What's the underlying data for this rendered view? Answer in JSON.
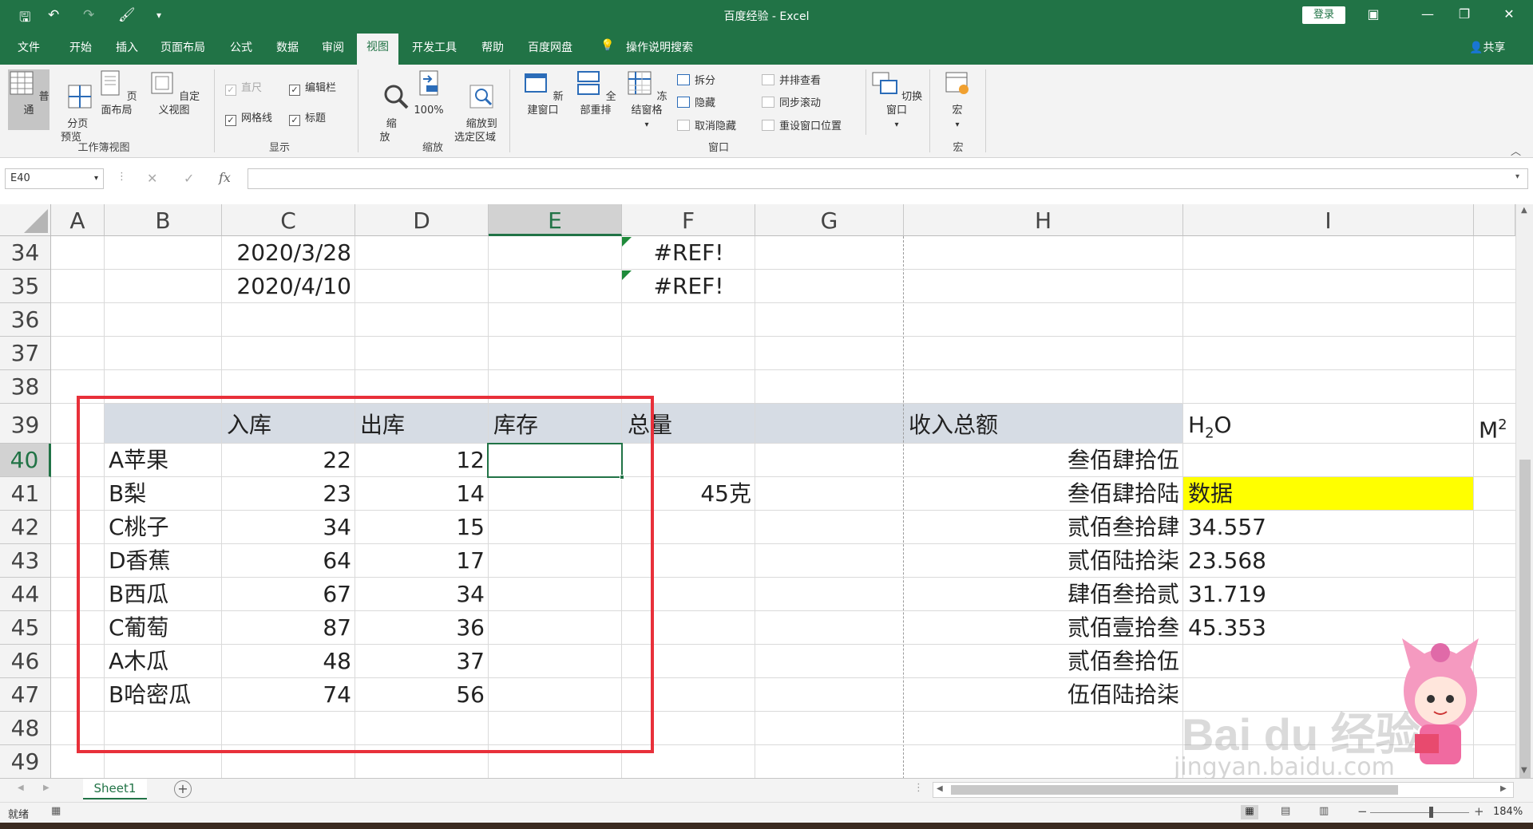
{
  "window": {
    "title": "百度经验  -  Excel",
    "login": "登录",
    "share": "共享",
    "controls": {
      "ribbon_options": "▣",
      "minimize": "—",
      "restore": "❐",
      "close": "✕"
    }
  },
  "quick_access": {
    "save": "🖫",
    "undo": "↶",
    "redo": "↷",
    "format_painter": "🖌",
    "more": "▾"
  },
  "menu_tabs": [
    "文件",
    "开始",
    "插入",
    "页面布局",
    "公式",
    "数据",
    "审阅",
    "视图",
    "开发工具",
    "帮助",
    "百度网盘",
    "操作说明搜索"
  ],
  "active_tab": "视图",
  "ribbon": {
    "workbook_views": {
      "label": "工作簿视图",
      "normal": "普通",
      "page_break": "分页\n预览",
      "page_layout": "页面布局",
      "custom": "自定义视图"
    },
    "show": {
      "label": "显示",
      "ruler": "直尺",
      "formula_bar": "编辑栏",
      "gridlines": "网格线",
      "headings": "标题"
    },
    "zoom": {
      "label": "缩放",
      "zoom": "缩\n放",
      "zoom100": "100%",
      "zoom_selection": "缩放到\n选定区域"
    },
    "window": {
      "label": "窗口",
      "new_window": "新建窗口",
      "arrange_all": "全部重排",
      "freeze": "冻结窗格",
      "split": "拆分",
      "hide": "隐藏",
      "unhide": "取消隐藏",
      "side_by_side": "并排查看",
      "sync_scroll": "同步滚动",
      "reset_pos": "重设窗口位置",
      "switch": "切换窗口"
    },
    "macros": {
      "label": "宏",
      "macro": "宏"
    }
  },
  "formula_bar": {
    "name_box": "E40",
    "cancel": "✕",
    "enter": "✓",
    "fx": "fx",
    "value": ""
  },
  "columns": [
    "A",
    "B",
    "C",
    "D",
    "E",
    "F",
    "G",
    "H",
    "I"
  ],
  "rows": [
    "34",
    "35",
    "36",
    "37",
    "38",
    "39",
    "40",
    "41",
    "42",
    "43",
    "44",
    "45",
    "46",
    "47",
    "48",
    "49"
  ],
  "selected_cell": "E40",
  "cells": {
    "C34": "2020/3/28",
    "F34": "#REF!",
    "C35": "2020/4/10",
    "F35": "#REF!",
    "C39": "入库",
    "D39": "出库",
    "E39": "库存",
    "F39": "总量",
    "H39": "收入总额",
    "I39_base": "H",
    "I39_sub": "2",
    "I39_tail": "O",
    "J39_base": "M",
    "J39_sup": "2",
    "B40": "A苹果",
    "C40": "22",
    "D40": "12",
    "H40": "叁佰肆拾伍",
    "B41": "B梨",
    "C41": "23",
    "D41": "14",
    "F41": "45克",
    "H41": "叁佰肆拾陆",
    "I41": "数据",
    "B42": "C桃子",
    "C42": "34",
    "D42": "15",
    "H42": "贰佰叁拾肆",
    "I42": "34.557",
    "B43": "D香蕉",
    "C43": "64",
    "D43": "17",
    "H43": "贰佰陆拾柒",
    "I43": "23.568",
    "B44": "B西瓜",
    "C44": "67",
    "D44": "34",
    "H44": "肆佰叁拾贰",
    "I44": "31.719",
    "B45": "C葡萄",
    "C45": "87",
    "D45": "36",
    "H45": "贰佰壹拾叁",
    "I45": "45.353",
    "B46": "A木瓜",
    "C46": "48",
    "D46": "37",
    "H46": "贰佰叁拾伍",
    "B47": "B哈密瓜",
    "C47": "74",
    "D47": "56",
    "H47": "伍佰陆拾柒"
  },
  "sheet_tabs": [
    "Sheet1"
  ],
  "add_sheet": "+",
  "status": {
    "ready": "就绪",
    "zoom": "184%",
    "zoom_minus": "−",
    "zoom_plus": "+"
  },
  "watermark": {
    "text": "Bai du 经验",
    "url": "jingyan.baidu.com"
  },
  "colors": {
    "excel_green": "#217346",
    "header_fill": "#d6dce4",
    "highlight": "#ffff00",
    "annotation_red": "#e8303a"
  }
}
